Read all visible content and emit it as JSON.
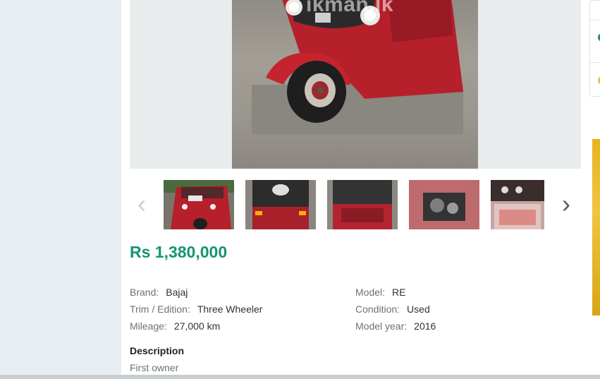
{
  "listing": {
    "watermark": "ikman.lk",
    "price": "Rs 1,380,000",
    "specs": {
      "brand_label": "Brand:",
      "brand": "Bajaj",
      "trim_label": "Trim / Edition:",
      "trim": "Three Wheeler",
      "mileage_label": "Mileage:",
      "mileage": "27,000 km",
      "model_label": "Model:",
      "model": "RE",
      "condition_label": "Condition:",
      "condition": "Used",
      "year_label": "Model year:",
      "year": "2016"
    },
    "description_heading": "Description",
    "description": "First owner"
  },
  "gallery": {
    "prev_icon": "‹",
    "next_icon": "›",
    "thumbnails": [
      "front-view",
      "rear-view-1",
      "rear-view-2",
      "engine-view",
      "interior-view"
    ]
  },
  "colors": {
    "price": "#159571",
    "vehicle_red": "#b5202a"
  }
}
